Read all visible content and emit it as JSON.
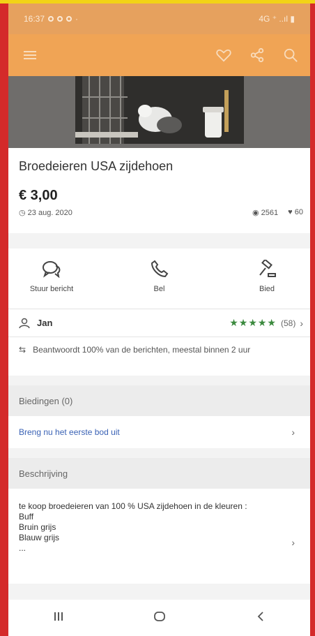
{
  "status": {
    "time": "16:37",
    "right": "4G ⁺ ..ıl ▮"
  },
  "listing": {
    "title": "Broedeieren USA zijdehoen",
    "price": "€ 3,00",
    "date": "23 aug. 2020",
    "views": "2561",
    "likes": "60"
  },
  "actions": [
    {
      "label": "Stuur bericht"
    },
    {
      "label": "Bel"
    },
    {
      "label": "Bied"
    }
  ],
  "seller": {
    "name": "Jan",
    "stars": "★★★★★",
    "reviews": "(58)"
  },
  "response": {
    "text": "Beantwoordt 100% van de berichten, meestal binnen 2 uur"
  },
  "bids": {
    "header": "Biedingen (0)",
    "cta": "Breng nu het eerste bod uit"
  },
  "description": {
    "header": "Beschrijving",
    "lines": [
      "te koop broedeieren van 100 % USA zijdehoen in de kleuren :",
      "Buff",
      "Bruin grijs",
      "Blauw grijs",
      "..."
    ]
  },
  "colors": {
    "appbar": "#f0a455",
    "statusbar": "#e6a15e",
    "link": "#3a62b5",
    "stars": "#3b8a3e"
  }
}
